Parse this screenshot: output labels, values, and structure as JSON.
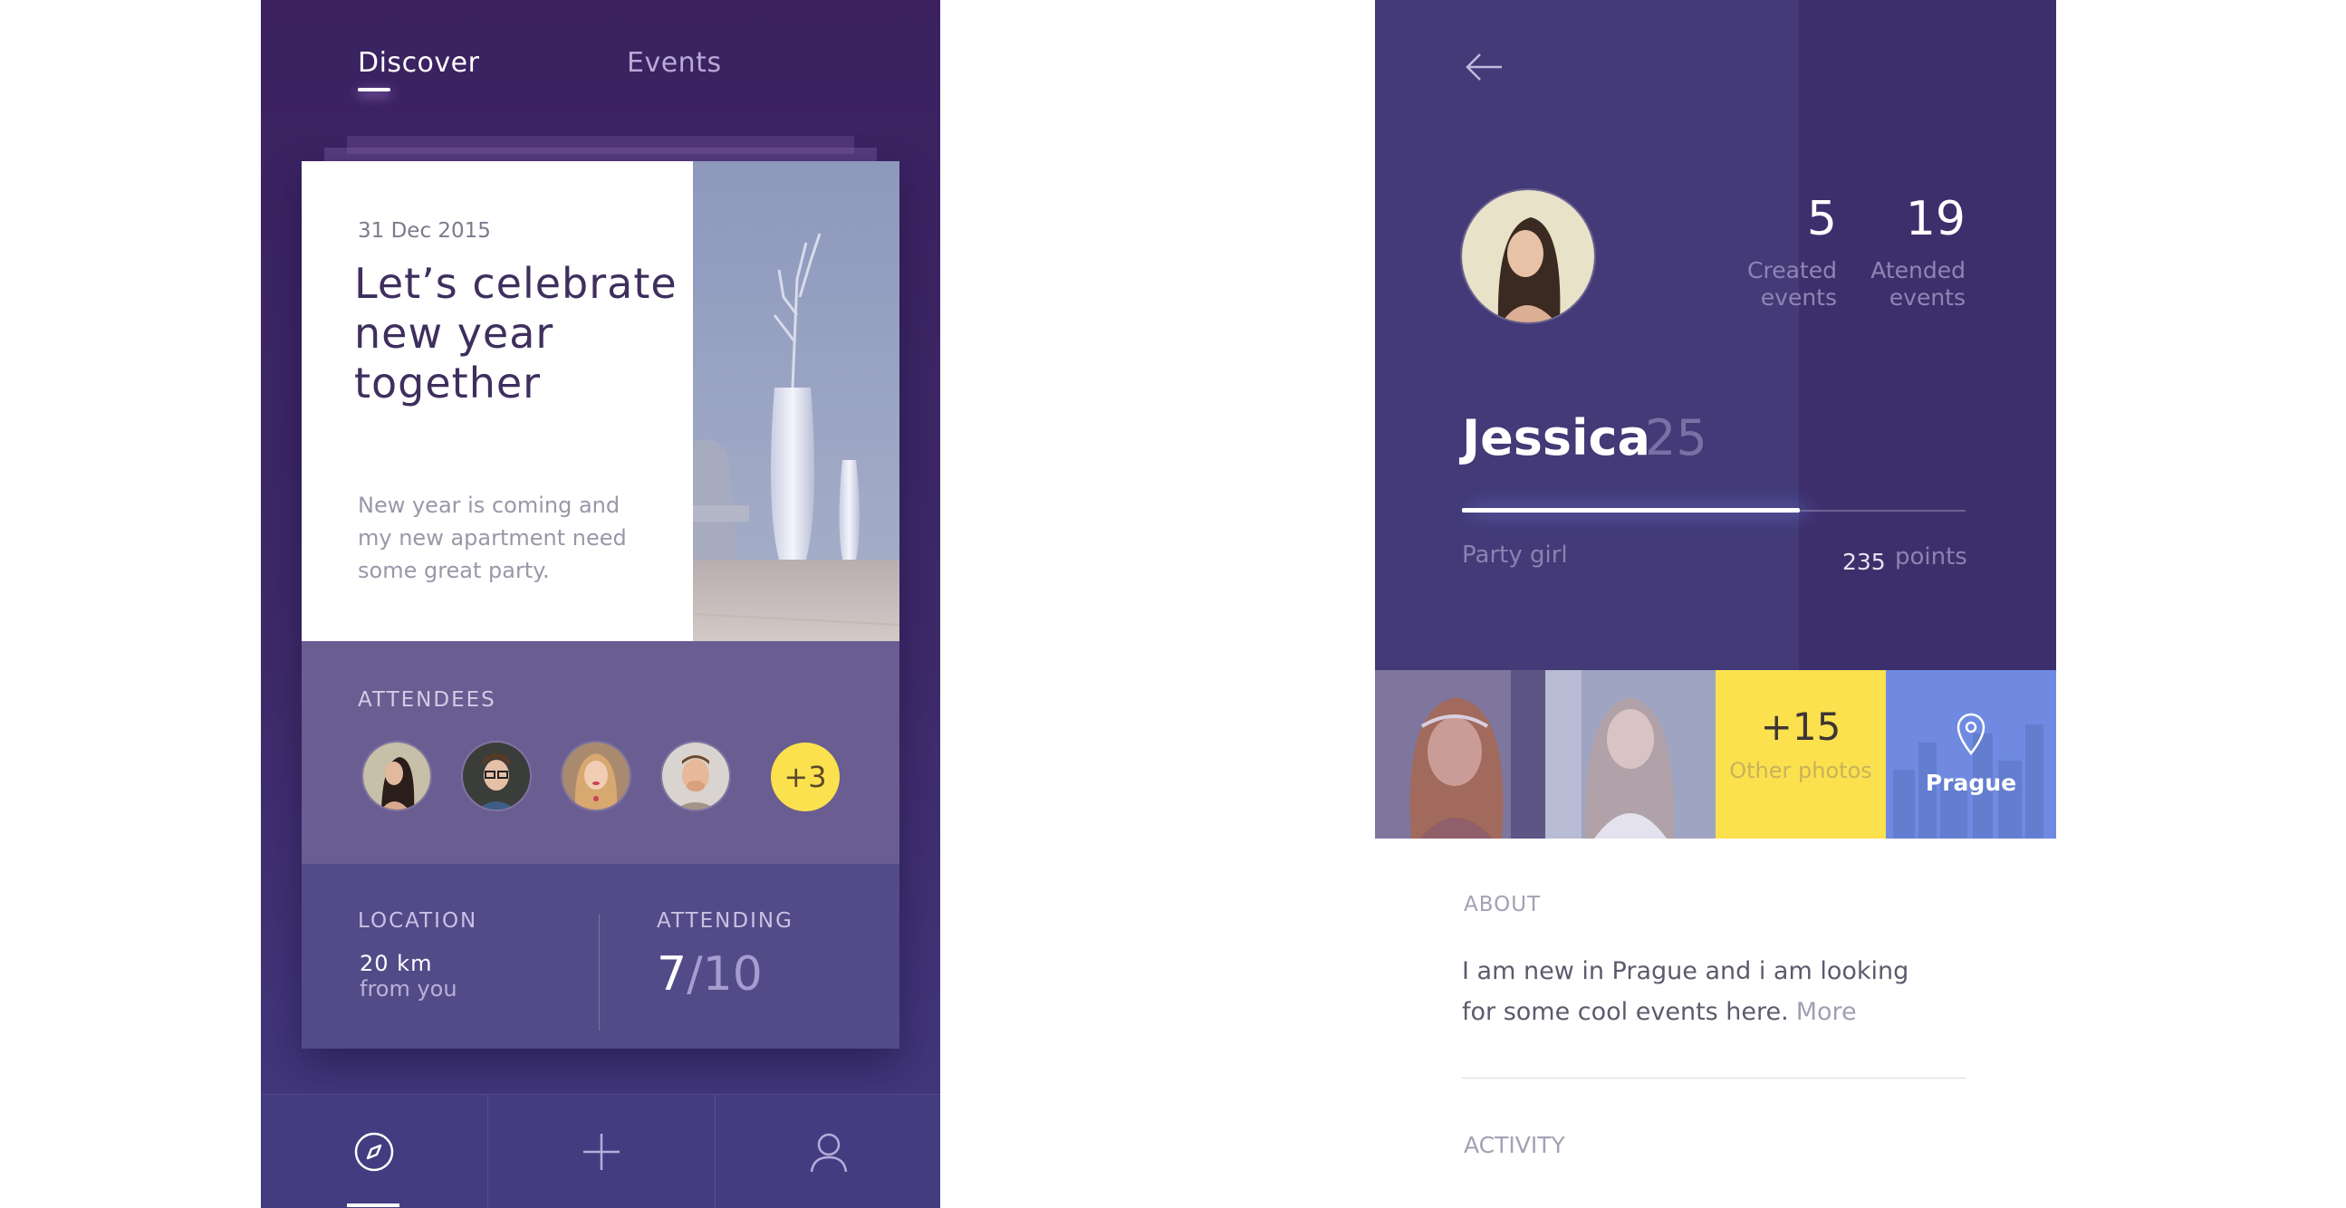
{
  "discover_screen": {
    "tabs": [
      {
        "label": "Discover",
        "active": true
      },
      {
        "label": "Events",
        "active": false
      }
    ],
    "event_card": {
      "date": "31 Dec 2015",
      "title": "Let’s celebrate new year together",
      "description": "New year is coming and my new apartment need some great party.",
      "attendees_label": "ATTENDEES",
      "extra_attendees": "+3",
      "location_label": "LOCATION",
      "location_value": "20 km",
      "location_sub": "from you",
      "attending_label": "ATTENDING",
      "attending_current": "7",
      "attending_total": "/10"
    },
    "bottom_nav": [
      {
        "icon": "compass-icon",
        "active": true
      },
      {
        "icon": "plus-icon",
        "active": false
      },
      {
        "icon": "user-icon",
        "active": false
      }
    ]
  },
  "profile_screen": {
    "stats": [
      {
        "value": "5",
        "label": "Created events"
      },
      {
        "value": "19",
        "label": "Atended events"
      }
    ],
    "name": "Jessica",
    "age": "25",
    "role": "Party girl",
    "points": "235",
    "points_label": "points",
    "points_progress": 0.67,
    "photos": {
      "other_count": "+15",
      "other_label": "Other photos",
      "city": "Prague"
    },
    "about_label": "ABOUT",
    "about_text": "I am new in Prague and i am looking for some cool events here.",
    "more_link": "More",
    "activity_label": "ACTIVITY"
  },
  "colors": {
    "primary_purple": "#3b2160",
    "card_attendees": "#695d92",
    "card_bottom": "#524b88",
    "accent_yellow": "#fbe14d",
    "accent_blue": "#6f8ae0"
  }
}
